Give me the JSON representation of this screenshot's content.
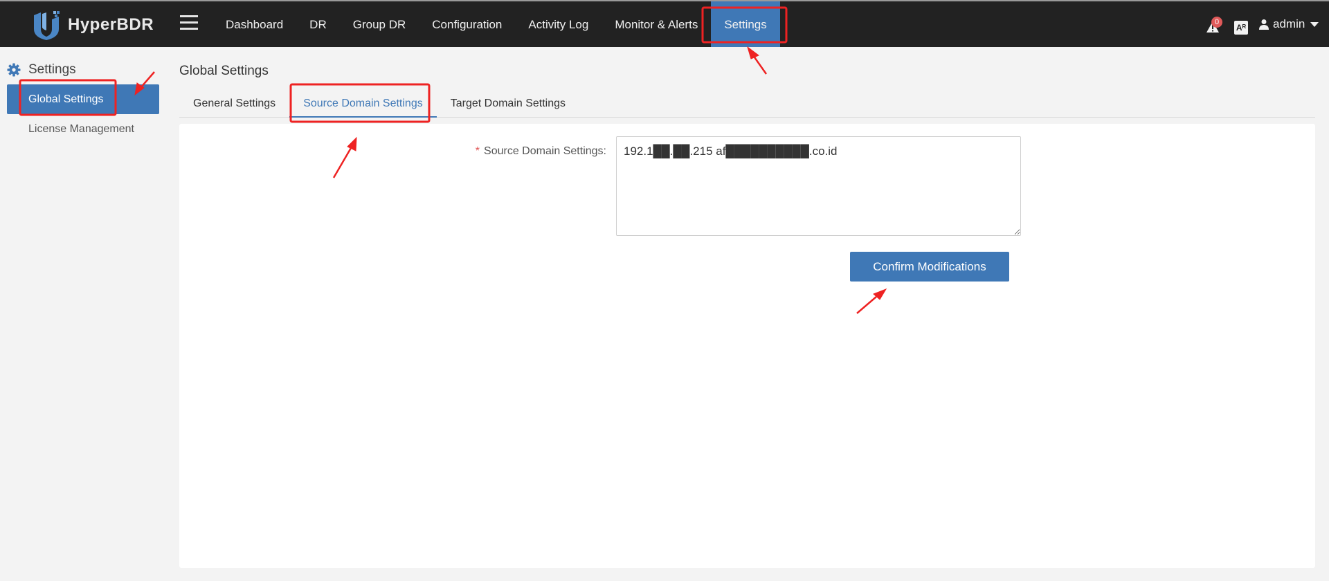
{
  "brand": {
    "name": "HyperBDR"
  },
  "nav": {
    "items": [
      {
        "label": "Dashboard"
      },
      {
        "label": "DR"
      },
      {
        "label": "Group DR"
      },
      {
        "label": "Configuration"
      },
      {
        "label": "Activity Log"
      },
      {
        "label": "Monitor & Alerts"
      },
      {
        "label": "Settings",
        "active": true
      }
    ]
  },
  "header": {
    "alert_count": "0",
    "lang_icon": "Aᴿ",
    "user_name": "admin"
  },
  "sidebar": {
    "title": "Settings",
    "items": [
      {
        "label": "Global Settings",
        "active": true
      },
      {
        "label": "License Management"
      }
    ]
  },
  "main": {
    "title": "Global Settings",
    "tabs": [
      {
        "label": "General Settings"
      },
      {
        "label": "Source Domain Settings",
        "active": true
      },
      {
        "label": "Target Domain Settings"
      }
    ],
    "form": {
      "required_mark": "*",
      "label": "Source Domain Settings:",
      "value": "192.1██.██.215 af██████████.co.id",
      "confirm_label": "Confirm Modifications"
    }
  },
  "colors": {
    "topbar": "#222222",
    "accent": "#3f78b6",
    "annotation": "#ee2222"
  },
  "icons": {
    "logo": "shield-logo-icon",
    "menu": "hamburger-icon",
    "alert": "warning-icon",
    "language": "language-icon",
    "user": "user-icon",
    "settings": "gear-icon"
  }
}
